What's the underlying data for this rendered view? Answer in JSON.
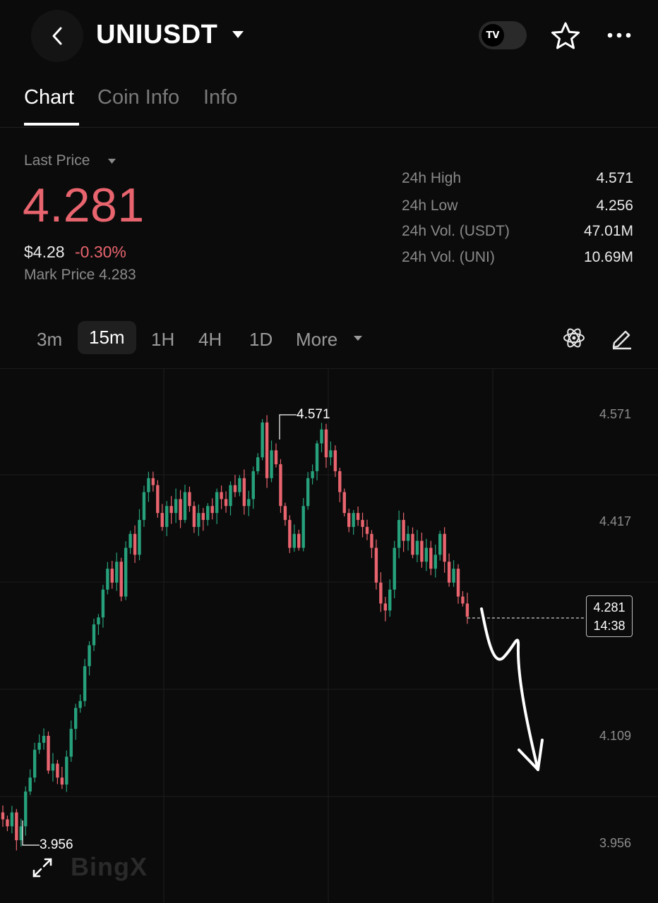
{
  "header": {
    "title": "UNIUSDT",
    "tv_badge": "TV"
  },
  "tabs": [
    {
      "label": "Chart",
      "active": true
    },
    {
      "label": "Coin Info",
      "active": false
    },
    {
      "label": "Info",
      "active": false
    }
  ],
  "price": {
    "last_label": "Last Price",
    "last_price": "4.281",
    "usd_price": "$4.28",
    "change_pct": "-0.30%",
    "mark_price": "Mark Price 4.283"
  },
  "stats": [
    {
      "label": "24h High",
      "value": "4.571"
    },
    {
      "label": "24h Low",
      "value": "4.256"
    },
    {
      "label": "24h Vol. (USDT)",
      "value": "47.01M"
    },
    {
      "label": "24h Vol. (UNI)",
      "value": "10.69M"
    }
  ],
  "timeframes": [
    {
      "label": "3m",
      "active": false
    },
    {
      "label": "15m",
      "active": true
    },
    {
      "label": "1H",
      "active": false
    },
    {
      "label": "4H",
      "active": false
    },
    {
      "label": "1D",
      "active": false
    },
    {
      "label": "More",
      "active": false
    }
  ],
  "chart": {
    "y_ticks": [
      "4.571",
      "4.417",
      "4.109",
      "3.956"
    ],
    "high_marker": "4.571",
    "low_marker": "3.956",
    "current_price": "4.281",
    "countdown": "14:38",
    "watermark": "BingX",
    "up_color": "#26a17b",
    "down_color": "#e8646e"
  },
  "chart_data": {
    "type": "candlestick",
    "title": "",
    "ylim": [
      3.9,
      4.62
    ],
    "y_ticks": [
      4.571,
      4.417,
      4.109,
      3.956
    ],
    "closes": [
      3.99,
      3.98,
      4.0,
      3.96,
      3.98,
      4.03,
      4.05,
      4.09,
      4.1,
      4.11,
      4.06,
      4.07,
      4.05,
      4.04,
      4.08,
      4.12,
      4.15,
      4.16,
      4.21,
      4.24,
      4.27,
      4.28,
      4.32,
      4.35,
      4.33,
      4.36,
      4.31,
      4.38,
      4.4,
      4.37,
      4.42,
      4.46,
      4.48,
      4.47,
      4.43,
      4.41,
      4.44,
      4.43,
      4.45,
      4.42,
      4.46,
      4.44,
      4.41,
      4.43,
      4.42,
      4.44,
      4.43,
      4.46,
      4.45,
      4.44,
      4.47,
      4.46,
      4.48,
      4.44,
      4.45,
      4.49,
      4.51,
      4.56,
      4.48,
      4.52,
      4.5,
      4.44,
      4.42,
      4.38,
      4.4,
      4.38,
      4.44,
      4.48,
      4.49,
      4.53,
      4.55,
      4.51,
      4.52,
      4.49,
      4.46,
      4.43,
      4.41,
      4.43,
      4.42,
      4.41,
      4.4,
      4.38,
      4.33,
      4.3,
      4.29,
      4.32,
      4.38,
      4.42,
      4.39,
      4.4,
      4.37,
      4.39,
      4.36,
      4.38,
      4.35,
      4.37,
      4.4,
      4.36,
      4.33,
      4.35,
      4.31,
      4.3,
      4.281
    ]
  }
}
